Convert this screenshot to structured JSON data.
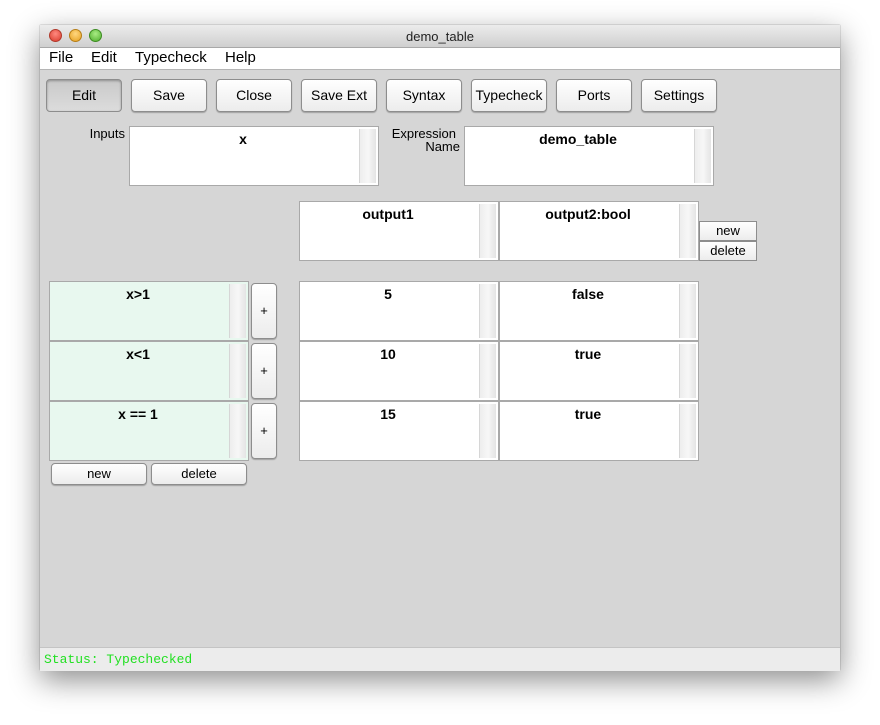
{
  "window": {
    "title": "demo_table"
  },
  "menu": [
    "File",
    "Edit",
    "Typecheck",
    "Help"
  ],
  "toolbar": {
    "edit": "Edit",
    "save": "Save",
    "close": "Close",
    "save_ext": "Save Ext",
    "syntax": "Syntax",
    "typecheck": "Typecheck",
    "ports": "Ports",
    "settings": "Settings"
  },
  "form": {
    "inputs_label": "Inputs",
    "inputs_value": "x",
    "expr_label_1": "Expression",
    "expr_label_2": "Name",
    "expr_value": "demo_table"
  },
  "outputs": {
    "headers": [
      "output1",
      "output2:bool"
    ],
    "new_label": "new",
    "delete_label": "delete"
  },
  "rows": [
    {
      "condition": "x>1",
      "values": [
        "5",
        "false"
      ]
    },
    {
      "condition": "x<1",
      "values": [
        "10",
        "true"
      ]
    },
    {
      "condition": "x == 1",
      "values": [
        "15",
        "true"
      ]
    }
  ],
  "row_add_label": "+",
  "condition_buttons": {
    "new": "new",
    "delete": "delete"
  },
  "status": {
    "text": "Status: Typechecked",
    "color": "#22e022"
  }
}
